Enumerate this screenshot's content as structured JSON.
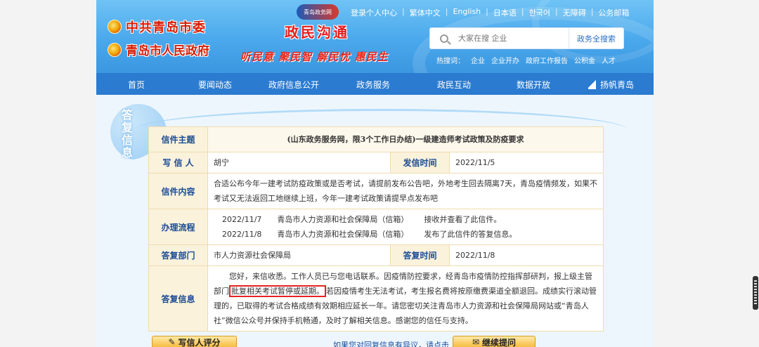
{
  "header": {
    "logo_party": "中共青岛市委",
    "logo_gov": "青岛市人民政府",
    "site_badge": "青岛政务网",
    "site_title": "政民沟通",
    "slogan": "听民意 聚民智 解民忧 惠民生",
    "toplinks": [
      "登录个人中心",
      "繁体中文",
      "English",
      "日本语",
      "한국어",
      "无障碍",
      "公务邮箱"
    ],
    "search_placeholder": "大家在搜 企业",
    "search_button": "政务全搜索",
    "hotwords_label": "热搜词：",
    "hotwords": [
      "企业",
      "企业开办",
      "政府工作报告",
      "公积金",
      "人才"
    ]
  },
  "nav": [
    "首页",
    "要闻动态",
    "政府信息公开",
    "政务服务",
    "政民互动",
    "数据开放",
    "扬帆青岛"
  ],
  "side_tag": "答复信息",
  "letter": {
    "subject_label": "信件主题",
    "subject": "(山东政务服务网，限3个工作日办结)一级建造师考试政策及防疫要求",
    "writer_label": "写 信 人",
    "writer": "胡宁",
    "sent_label": "发信时间",
    "sent_time": "2022/11/5",
    "content_label": "信件内容",
    "content": "合适公布今年一建考试防疫政策或是否考试，请提前发布公告吧，外地考生回去隔离7天，青岛疫情频发，如果不考试又无法返回工地继续上班，今年一建考试政策请提早点发布吧",
    "process_label": "办理流程",
    "process": [
      {
        "date": "2022/11/7",
        "dept": "青岛市人力资源和社会保障局（信箱）",
        "action": "接收并查看了此信件。"
      },
      {
        "date": "2022/11/8",
        "dept": "青岛市人力资源和社会保障局（信箱）",
        "action": "发布了此信件的答复信息。"
      }
    ],
    "reply_dept_label": "答复部门",
    "reply_dept": "市人力资源社会保障局",
    "reply_time_label": "答复时间",
    "reply_time": "2022/11/8",
    "reply_label": "答复信息",
    "reply_part1": "　　您好，来信收悉。工作人员已与您电话联系。因疫情防控要求，经青岛市疫情防控指挥部研判，报上级主管部门",
    "reply_highlight": "批复相关考试暂停或延期。",
    "reply_part2": "若因疫情考生无法考试，考生报名费将按原缴费渠道全额退回。成绩实行滚动管理的，已取得的考试合格成绩有效期相应延长一年。请您密切关注青岛市人力资源和社会保障局网站或“青岛人社”微信公众号并保持手机畅通，及时了解相关信息。感谢您的信任与支持。"
  },
  "bottom": {
    "rate_button": "写信人评分",
    "doubt_text": "如果您对回复信息有异议，请点击",
    "continue_button": "继续提问"
  }
}
